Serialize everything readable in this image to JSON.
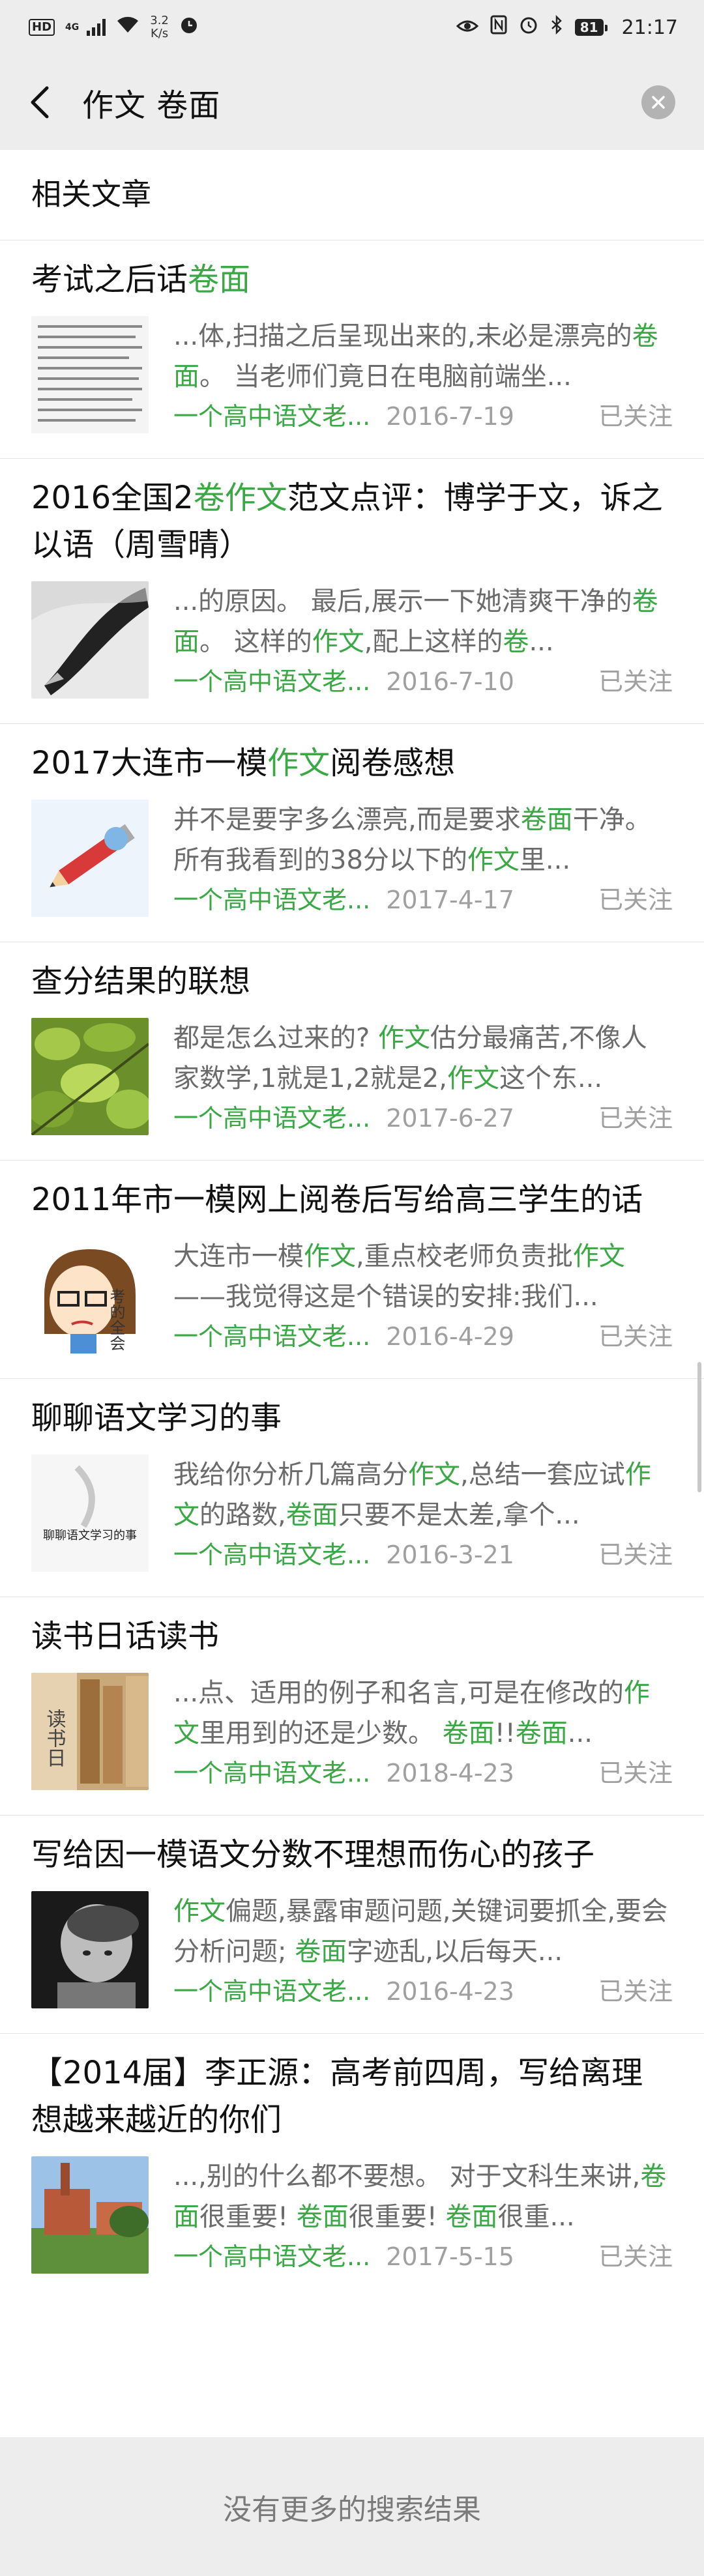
{
  "status_bar": {
    "hd": "HD",
    "network": "4G",
    "speed_value": "3.2",
    "speed_unit": "K/s",
    "battery": "81",
    "time": "21:17"
  },
  "search": {
    "query": "作文 卷面"
  },
  "section_title": "相关文章",
  "results": [
    {
      "title": [
        {
          "t": "考试之后话"
        },
        {
          "t": "卷面",
          "hl": true
        }
      ],
      "snippet": [
        {
          "t": "...体,扫描之后呈现出来的,未必是漂亮的"
        },
        {
          "t": "卷面",
          "hl": true
        },
        {
          "t": "。 当老师们竟日在电脑前端坐..."
        }
      ],
      "source": "一个高中语文老...",
      "date": "2016-7-19",
      "follow": "已关注",
      "thumb": "scanned-paper-thumbnail"
    },
    {
      "title": [
        {
          "t": "2016全国2"
        },
        {
          "t": "卷",
          "hl": true
        },
        {
          "t": "作文",
          "hl": true
        },
        {
          "t": "范文点评：博学于文，诉之以语（周雪晴）"
        }
      ],
      "snippet": [
        {
          "t": "...的原因。 最后,展示一下她清爽干净的"
        },
        {
          "t": "卷面",
          "hl": true
        },
        {
          "t": "。 这样的"
        },
        {
          "t": "作文",
          "hl": true
        },
        {
          "t": ",配上这样的"
        },
        {
          "t": "卷",
          "hl": true
        },
        {
          "t": "..."
        }
      ],
      "source": "一个高中语文老...",
      "date": "2016-7-10",
      "follow": "已关注",
      "thumb": "fountain-pen-thumbnail"
    },
    {
      "title": [
        {
          "t": "2017大连市一模"
        },
        {
          "t": "作文",
          "hl": true
        },
        {
          "t": "阅卷感想"
        }
      ],
      "snippet": [
        {
          "t": "并不是要字多么漂亮,而是要求"
        },
        {
          "t": "卷面",
          "hl": true
        },
        {
          "t": "干净。 所有我看到的38分以下的"
        },
        {
          "t": "作文",
          "hl": true
        },
        {
          "t": "里..."
        }
      ],
      "source": "一个高中语文老...",
      "date": "2017-4-17",
      "follow": "已关注",
      "thumb": "pencil-cartoon-thumbnail"
    },
    {
      "title": [
        {
          "t": "查分结果的联想"
        }
      ],
      "snippet": [
        {
          "t": "都是怎么过来的? "
        },
        {
          "t": "作文",
          "hl": true
        },
        {
          "t": "估分最痛苦,不像人家数学,1就是1,2就是2,"
        },
        {
          "t": "作文",
          "hl": true
        },
        {
          "t": "这个东..."
        }
      ],
      "source": "一个高中语文老...",
      "date": "2017-6-27",
      "follow": "已关注",
      "thumb": "green-leaves-thumbnail"
    },
    {
      "title": [
        {
          "t": "2011年市一模网上阅卷后写给高三学生的话"
        }
      ],
      "snippet": [
        {
          "t": "大连市一模"
        },
        {
          "t": "作文",
          "hl": true
        },
        {
          "t": ",重点校老师负责批"
        },
        {
          "t": "作文",
          "hl": true
        },
        {
          "t": "——我觉得这是个错误的安排:我们..."
        }
      ],
      "source": "一个高中语文老...",
      "date": "2016-4-29",
      "follow": "已关注",
      "thumb": "cartoon-girl-thumbnail",
      "thumb_text": "考的全会"
    },
    {
      "title": [
        {
          "t": "聊聊语文学习的事"
        }
      ],
      "snippet": [
        {
          "t": "我给你分析几篇高分"
        },
        {
          "t": "作文",
          "hl": true
        },
        {
          "t": ",总结一套应试"
        },
        {
          "t": "作文",
          "hl": true
        },
        {
          "t": "的路数,"
        },
        {
          "t": "卷面",
          "hl": true
        },
        {
          "t": "只要不是太差,拿个..."
        }
      ],
      "source": "一个高中语文老...",
      "date": "2016-3-21",
      "follow": "已关注",
      "thumb": "calligraphy-cover-thumbnail",
      "thumb_text": "聊聊语文学习的事"
    },
    {
      "title": [
        {
          "t": "读书日话读书"
        }
      ],
      "snippet": [
        {
          "t": "...点、适用的例子和名言,可是在修改的"
        },
        {
          "t": "作文",
          "hl": true
        },
        {
          "t": "里用到的还是少数。 "
        },
        {
          "t": "卷面",
          "hl": true
        },
        {
          "t": "!!"
        },
        {
          "t": "卷面",
          "hl": true
        },
        {
          "t": "..."
        }
      ],
      "source": "一个高中语文老...",
      "date": "2018-4-23",
      "follow": "已关注",
      "thumb": "books-thumbnail",
      "thumb_text": "读书日"
    },
    {
      "title": [
        {
          "t": "写给因一模语文分数不理想而伤心的孩子"
        }
      ],
      "snippet": [
        {
          "t": "作文",
          "hl": true
        },
        {
          "t": "偏题,暴露审题问题,关键词要抓全,要会分析问题; "
        },
        {
          "t": "卷面",
          "hl": true
        },
        {
          "t": "字迹乱,以后每天..."
        }
      ],
      "source": "一个高中语文老...",
      "date": "2016-4-23",
      "follow": "已关注",
      "thumb": "sad-child-thumbnail"
    },
    {
      "title": [
        {
          "t": "【2014届】李正源：高考前四周，写给离理想越来越近的你们"
        }
      ],
      "snippet": [
        {
          "t": "...,别的什么都不要想。 对于文科生来讲,"
        },
        {
          "t": "卷面",
          "hl": true
        },
        {
          "t": "很重要! "
        },
        {
          "t": "卷面",
          "hl": true
        },
        {
          "t": "很重要! "
        },
        {
          "t": "卷面",
          "hl": true
        },
        {
          "t": "很重..."
        }
      ],
      "source": "一个高中语文老...",
      "date": "2017-5-15",
      "follow": "已关注",
      "thumb": "campus-building-thumbnail"
    }
  ],
  "footer": "没有更多的搜索结果",
  "colors": {
    "highlight": "#3aa845",
    "header_bg": "#ededed",
    "muted": "#a0a0a0"
  }
}
